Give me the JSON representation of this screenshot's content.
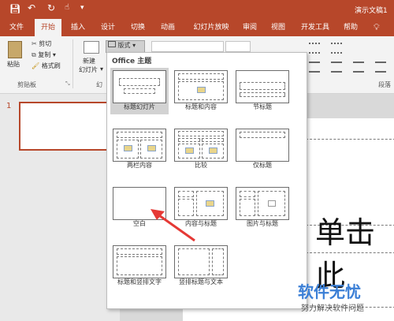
{
  "titlebar": {
    "doc_title": "演示文稿1",
    "autosave_icon": "save-icon",
    "undo_icon": "undo-icon",
    "redo_icon": "redo-icon"
  },
  "tabs": [
    "文件",
    "开始",
    "插入",
    "设计",
    "切换",
    "动画",
    "幻灯片放映",
    "审阅",
    "视图",
    "开发工具",
    "帮助"
  ],
  "active_tab": "开始",
  "ribbon": {
    "paste": "粘贴",
    "cut": "剪切",
    "copy": "复制",
    "format_painter": "格式刷",
    "clipboard_group": "剪贴板",
    "new_slide": "新建",
    "new_slide_2": "幻灯片",
    "slides_group_partial": "幻",
    "layout_button": "版式",
    "paragraph_group_partial": "段落"
  },
  "dropdown": {
    "header": "Office 主题",
    "layouts": [
      "标题幻灯片",
      "标题和内容",
      "节标题",
      "两栏内容",
      "比较",
      "仅标题",
      "空白",
      "内容与标题",
      "图片与标题",
      "标题和竖排文字",
      "竖排标题与文本"
    ],
    "selected": "标题幻灯片"
  },
  "slide_number": "1",
  "slide_placeholder_text": "单击此",
  "watermark": {
    "name": "软件无忧",
    "tagline": "努力解决软件问题"
  },
  "colors": {
    "accent": "#b7472a",
    "arrow": "#e53935"
  }
}
